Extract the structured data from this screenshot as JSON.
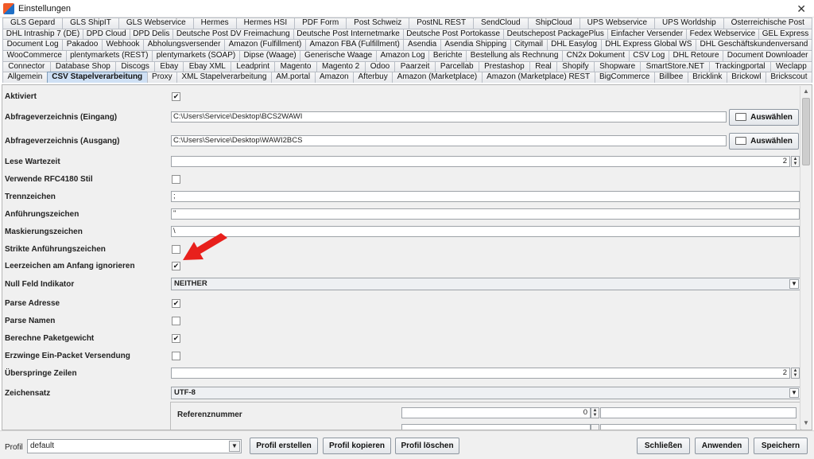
{
  "window": {
    "title": "Einstellungen",
    "close": "✕"
  },
  "tabs": {
    "rows": [
      [
        "GLS Gepard",
        "GLS ShipIT",
        "GLS Webservice",
        "Hermes",
        "Hermes HSI",
        "PDF Form",
        "Post Schweiz",
        "PostNL REST",
        "SendCloud",
        "ShipCloud",
        "UPS Webservice",
        "UPS Worldship",
        "Österreichische Post"
      ],
      [
        "DHL Intraship 7 (DE)",
        "DPD Cloud",
        "DPD Delis",
        "Deutsche Post DV Freimachung",
        "Deutsche Post Internetmarke",
        "Deutsche Post Portokasse",
        "Deutschepost PackagePlus",
        "Einfacher Versender",
        "Fedex Webservice",
        "GEL Express"
      ],
      [
        "Document Log",
        "Pakadoo",
        "Webhook",
        "Abholungsversender",
        "Amazon (Fulfillment)",
        "Amazon FBA (Fulfillment)",
        "Asendia",
        "Asendia Shipping",
        "Citymail",
        "DHL Easylog",
        "DHL Express Global WS",
        "DHL Geschäftskundenversand"
      ],
      [
        "WooCommerce",
        "plentymarkets (REST)",
        "plentymarkets (SOAP)",
        "Dipse (Waage)",
        "Generische Waage",
        "Amazon Log",
        "Berichte",
        "Bestellung als Rechnung",
        "CN2x Dokument",
        "CSV Log",
        "DHL Retoure",
        "Document Downloader"
      ],
      [
        "Connector",
        "Database Shop",
        "Discogs",
        "Ebay",
        "Ebay XML",
        "Leadprint",
        "Magento",
        "Magento 2",
        "Odoo",
        "Paarzeit",
        "Parcellab",
        "Prestashop",
        "Real",
        "Shopify",
        "Shopware",
        "SmartStore.NET",
        "Trackingportal",
        "Weclapp"
      ],
      [
        "Allgemein",
        "CSV Stapelverarbeitung",
        "Proxy",
        "XML Stapelverarbeitung",
        "AM.portal",
        "Amazon",
        "Afterbuy",
        "Amazon (Marketplace)",
        "Amazon (Marketplace) REST",
        "BigCommerce",
        "Billbee",
        "Bricklink",
        "Brickowl",
        "Brickscout"
      ]
    ],
    "active": "CSV Stapelverarbeitung"
  },
  "form": {
    "aktiviert": {
      "label": "Aktiviert",
      "checked": "✔"
    },
    "eingang": {
      "label": "Abfrageverzeichnis (Eingang)",
      "value": "C:\\Users\\Service\\Desktop\\BCS2WAWI",
      "button": "Auswählen"
    },
    "ausgang": {
      "label": "Abfrageverzeichnis (Ausgang)",
      "value": "C:\\Users\\Service\\Desktop\\WAWI2BCS",
      "button": "Auswählen"
    },
    "wartezeit": {
      "label": "Lese Wartezeit",
      "value": "2"
    },
    "rfc": {
      "label": "Verwende RFC4180 Stil",
      "checked": ""
    },
    "trennzeichen": {
      "label": "Trennzeichen",
      "value": ";"
    },
    "anfuehrung": {
      "label": "Anführungszeichen",
      "value": "\""
    },
    "maskierung": {
      "label": "Maskierungszeichen",
      "value": "\\"
    },
    "strikte": {
      "label": "Strikte Anführungszeichen",
      "checked": ""
    },
    "leerzeichen": {
      "label": "Leerzeichen am Anfang ignorieren",
      "checked": "✔"
    },
    "nullfeld": {
      "label": "Null Feld Indikator",
      "value": "NEITHER"
    },
    "parseadresse": {
      "label": "Parse Adresse",
      "checked": "✔"
    },
    "parsenamen": {
      "label": "Parse Namen",
      "checked": ""
    },
    "paketgewicht": {
      "label": "Berechne Paketgewicht",
      "checked": "✔"
    },
    "einpacket": {
      "label": "Erzwinge Ein-Packet Versendung",
      "checked": ""
    },
    "ueberspringe": {
      "label": "Überspringe Zeilen",
      "value": "2"
    },
    "zeichensatz": {
      "label": "Zeichensatz",
      "value": "UTF-8"
    },
    "referenz": {
      "label": "Referenznummer",
      "value": "0"
    }
  },
  "bottom": {
    "profile_label": "Profil",
    "profile_value": "default",
    "create": "Profil erstellen",
    "copy": "Profil kopieren",
    "delete": "Profil löschen",
    "close": "Schließen",
    "apply": "Anwenden",
    "save": "Speichern"
  },
  "colors": {
    "active_tab": "#cfe0f4",
    "arrow": "#e8201c",
    "panel": "#f0f0f0"
  }
}
